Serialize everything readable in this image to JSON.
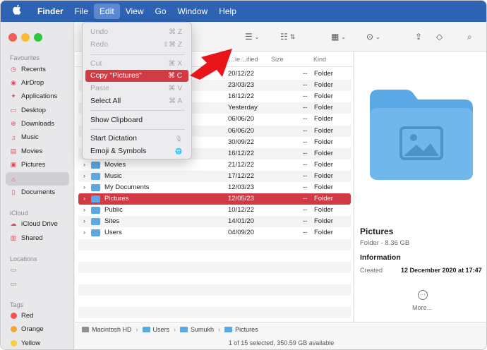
{
  "menubar": {
    "apple": "",
    "items": [
      "Finder",
      "File",
      "Edit",
      "View",
      "Go",
      "Window",
      "Help"
    ],
    "active_item": "Edit"
  },
  "edit_menu": {
    "items": [
      {
        "label": "Undo",
        "shortcut": "⌘ Z",
        "enabled": false
      },
      {
        "label": "Redo",
        "shortcut": "⇧⌘ Z",
        "enabled": false
      },
      {
        "label": "Cut",
        "shortcut": "⌘ X",
        "enabled": false
      },
      {
        "label": "Copy \"Pictures\"",
        "shortcut": "⌘ C",
        "enabled": true,
        "highlighted": true
      },
      {
        "label": "Paste",
        "shortcut": "⌘ V",
        "enabled": false
      },
      {
        "label": "Select All",
        "shortcut": "⌘ A",
        "enabled": true
      },
      {
        "label": "Show Clipboard",
        "shortcut": "",
        "enabled": true
      },
      {
        "label": "Start Dictation",
        "shortcut": "🎙",
        "enabled": true
      },
      {
        "label": "Emoji & Symbols",
        "shortcut": "🌐",
        "enabled": true
      }
    ]
  },
  "sidebar": {
    "favourites_heading": "Favourites",
    "favourites": [
      "Recents",
      "AirDrop",
      "Applications",
      "Desktop",
      "Downloads",
      "Music",
      "Movies",
      "Pictures",
      "",
      "Documents"
    ],
    "icloud_heading": "iCloud",
    "icloud": [
      "iCloud Drive",
      "Shared"
    ],
    "locations_heading": "Locations",
    "tags_heading": "Tags",
    "tags": [
      {
        "label": "Red",
        "color": "#f2554c"
      },
      {
        "label": "Orange",
        "color": "#f5a33b"
      },
      {
        "label": "Yellow",
        "color": "#f5cf3d"
      }
    ]
  },
  "columns": {
    "date": "…ie…ified",
    "size": "Size",
    "kind": "Kind"
  },
  "files": [
    {
      "name": "",
      "date": "20/12/22",
      "size": "--",
      "kind": "Folder"
    },
    {
      "name": "",
      "date": "23/03/23",
      "size": "--",
      "kind": "Folder"
    },
    {
      "name": "",
      "date": "16/12/22",
      "size": "--",
      "kind": "Folder"
    },
    {
      "name": "",
      "date": "Yesterday",
      "size": "--",
      "kind": "Folder"
    },
    {
      "name": "",
      "date": "06/06/20",
      "size": "--",
      "kind": "Folder"
    },
    {
      "name": "",
      "date": "06/06/20",
      "size": "--",
      "kind": "Folder"
    },
    {
      "name": "",
      "date": "30/09/22",
      "size": "--",
      "kind": "Folder"
    },
    {
      "name": "",
      "date": "16/12/22",
      "size": "--",
      "kind": "Folder"
    },
    {
      "name": "Movies",
      "date": "21/12/22",
      "size": "--",
      "kind": "Folder"
    },
    {
      "name": "Music",
      "date": "17/12/22",
      "size": "--",
      "kind": "Folder"
    },
    {
      "name": "My Documents",
      "date": "12/03/23",
      "size": "--",
      "kind": "Folder"
    },
    {
      "name": "Pictures",
      "date": "12/05/23",
      "size": "--",
      "kind": "Folder"
    },
    {
      "name": "Public",
      "date": "10/12/22",
      "size": "--",
      "kind": "Folder"
    },
    {
      "name": "Sites",
      "date": "14/01/20",
      "size": "--",
      "kind": "Folder"
    },
    {
      "name": "Users",
      "date": "04/09/20",
      "size": "--",
      "kind": "Folder"
    }
  ],
  "selected_file": "Pictures",
  "preview": {
    "title": "Pictures",
    "subtitle": "Folder - 8.36 GB",
    "info_heading": "Information",
    "created_label": "Created",
    "created_value": "12 December 2020 at 17:47",
    "more_label": "More..."
  },
  "path": [
    "Macintosh HD",
    "Users",
    "Sumukh",
    "Pictures"
  ],
  "status": "1 of 15 selected, 350.59 GB available",
  "colors": {
    "menubar": "#2e63b3",
    "selection": "#d13a44",
    "folder": "#5aa9e4",
    "arrow": "#e8151b"
  }
}
